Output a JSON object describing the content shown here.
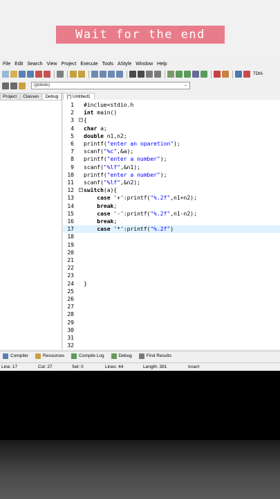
{
  "banner": {
    "text": "Wait for the end"
  },
  "menu": [
    "File",
    "Edit",
    "Search",
    "View",
    "Project",
    "Execute",
    "Tools",
    "AStyle",
    "Window",
    "Help"
  ],
  "toolbar": {
    "compiler_label": "TDM-",
    "scope_select": "(globals)"
  },
  "left_tabs": [
    "Project",
    "Classes",
    "Debug"
  ],
  "editor_tab": "[*] Untitled1",
  "code_lines": [
    "#inclue<stdio.h",
    "int main()",
    "{",
    "char a;",
    "double n1,n2;",
    "printf(\"enter an oparetion\");",
    "scanf(\"%c\",&a);",
    "printf(\"enter a number\");",
    "scanf(\"%lf\",&n1);",
    "printf(\"enter a number\");",
    "scanf(\"%lf\",&n2);",
    "switch(a){",
    "    case '+':printf(\"%.2f\",n1+n2);",
    "    break;",
    "    case '-':printf(\"%.2f\",n1-n2);",
    "    break;",
    "    case '*':printf(\"%.2f\")",
    "",
    "",
    "",
    "",
    "",
    "",
    "}",
    "",
    "",
    "",
    "",
    "",
    "",
    "",
    ""
  ],
  "line_numbers": [
    "1",
    "2",
    "3",
    "4",
    "5",
    "6",
    "7",
    "8",
    "9",
    "10",
    "11",
    "12",
    "13",
    "14",
    "15",
    "16",
    "17",
    "18",
    "19",
    "20",
    "21",
    "22",
    "23",
    "24",
    "25",
    "26",
    "27",
    "28",
    "29",
    "30",
    "31",
    "32"
  ],
  "bottom_tabs": [
    "Compiler",
    "Resources",
    "Compile Log",
    "Debug",
    "Find Results"
  ],
  "status": {
    "line": "Line:   17",
    "col": "Col:   27",
    "sel": "Sel:   0",
    "lines": "Lines:   44",
    "length": "Length:   391",
    "mode": "Insert"
  },
  "colors": {
    "banner_bg": "#e97c8a",
    "highlight_line": "#dff2ff",
    "string": "#0000ff"
  }
}
